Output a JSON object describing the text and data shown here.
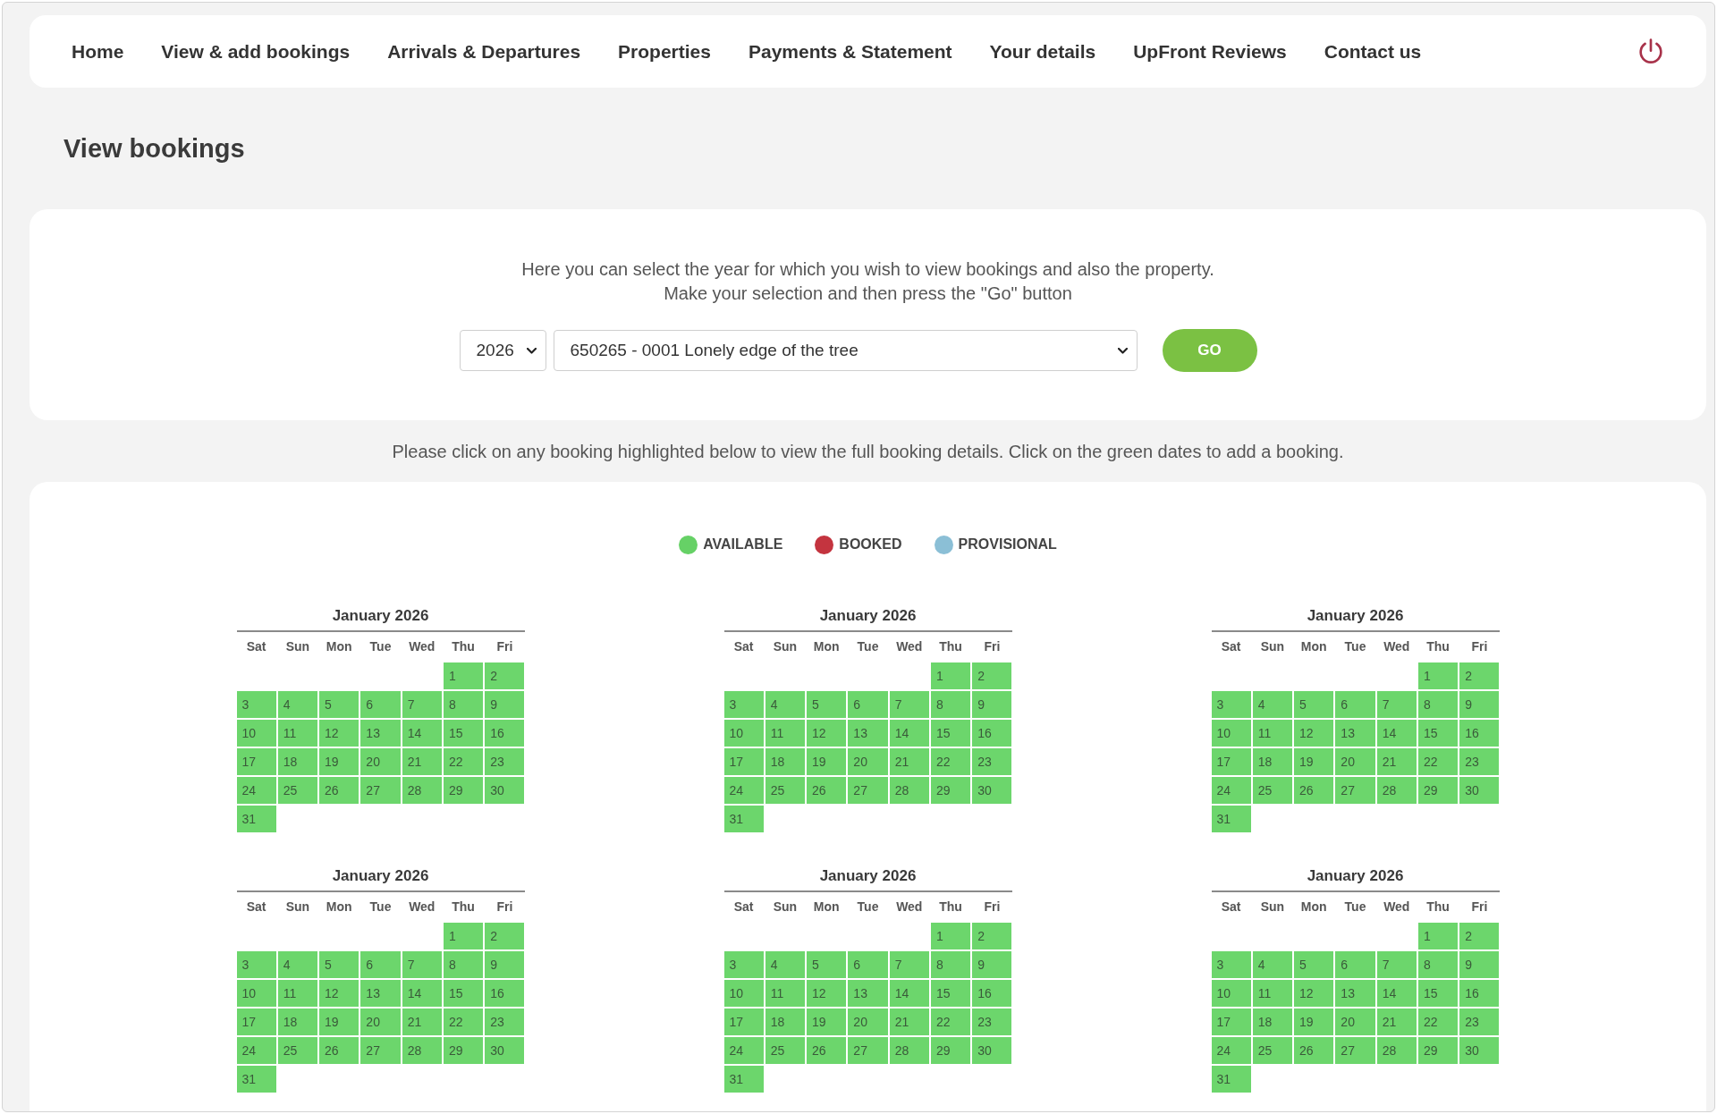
{
  "nav": {
    "links": [
      "Home",
      "View & add bookings",
      "Arrivals & Departures",
      "Properties",
      "Payments & Statement",
      "Your details",
      "UpFront Reviews",
      "Contact us"
    ]
  },
  "page_title": "View bookings",
  "selection_panel": {
    "intro": [
      "Here you can select the year for which you wish to view bookings and also the property.",
      "Make your selection and then press the \"Go\" button"
    ],
    "year_select": {
      "value": "2026"
    },
    "property_select": {
      "value": "650265 - 0001 Lonely edge of the tree"
    },
    "go_button": "GO"
  },
  "instruction": "Please click on any booking highlighted below to view the full booking details. Click on the green dates to add a booking.",
  "calendar_panel": {
    "legend": [
      {
        "label": "AVAILABLE",
        "color": "#66d166"
      },
      {
        "label": "BOOKED",
        "color": "#c4343f"
      },
      {
        "label": "PROVISIONAL",
        "color": "#8bbfd6"
      }
    ],
    "calendars": [
      {
        "title": "January 2026",
        "weekdays": [
          "Sat",
          "Sun",
          "Mon",
          "Tue",
          "Wed",
          "Thu",
          "Fri"
        ],
        "weeks": [
          [
            {
              "day": "1",
              "color": "#6cd66c"
            },
            {
              "day": "2",
              "color": "#6cd66c"
            }
          ],
          [
            {
              "day": "3",
              "color": "#6cd66c"
            },
            {
              "day": "4",
              "color": "#6cd66c"
            },
            {
              "day": "5",
              "color": "#6cd66c"
            },
            {
              "day": "6",
              "color": "#6cd66c"
            },
            {
              "day": "7",
              "color": "#6cd66c"
            },
            {
              "day": "8",
              "color": "#6cd66c"
            },
            {
              "day": "9",
              "color": "#6cd66c"
            }
          ],
          [
            {
              "day": "10",
              "color": "#6cd66c"
            },
            {
              "day": "11",
              "color": "#6cd66c"
            },
            {
              "day": "12",
              "color": "#6cd66c"
            },
            {
              "day": "13",
              "color": "#6cd66c"
            },
            {
              "day": "14",
              "color": "#6cd66c"
            },
            {
              "day": "15",
              "color": "#6cd66c"
            },
            {
              "day": "16",
              "color": "#6cd66c"
            }
          ],
          [
            {
              "day": "17",
              "color": "#6cd66c"
            },
            {
              "day": "18",
              "color": "#6cd66c"
            },
            {
              "day": "19",
              "color": "#6cd66c"
            },
            {
              "day": "20",
              "color": "#6cd66c"
            },
            {
              "day": "21",
              "color": "#6cd66c"
            },
            {
              "day": "22",
              "color": "#6cd66c"
            },
            {
              "day": "23",
              "color": "#6cd66c"
            }
          ],
          [
            {
              "day": "24",
              "color": "#6cd66c"
            },
            {
              "day": "25",
              "color": "#6cd66c"
            },
            {
              "day": "26",
              "color": "#6cd66c"
            },
            {
              "day": "27",
              "color": "#6cd66c"
            },
            {
              "day": "28",
              "color": "#6cd66c"
            },
            {
              "day": "29",
              "color": "#6cd66c"
            },
            {
              "day": "30",
              "color": "#6cd66c"
            }
          ],
          [
            {
              "day": "31",
              "color": "#6cd66c"
            }
          ]
        ]
      },
      {
        "title": "January 2026",
        "weekdays": [
          "Sat",
          "Sun",
          "Mon",
          "Tue",
          "Wed",
          "Thu",
          "Fri"
        ],
        "weeks": [
          [
            {
              "day": "1",
              "color": "#6cd66c"
            },
            {
              "day": "2",
              "color": "#6cd66c"
            }
          ],
          [
            {
              "day": "3",
              "color": "#6cd66c"
            },
            {
              "day": "4",
              "color": "#6cd66c"
            },
            {
              "day": "5",
              "color": "#6cd66c"
            },
            {
              "day": "6",
              "color": "#6cd66c"
            },
            {
              "day": "7",
              "color": "#6cd66c"
            },
            {
              "day": "8",
              "color": "#6cd66c"
            },
            {
              "day": "9",
              "color": "#6cd66c"
            }
          ],
          [
            {
              "day": "10",
              "color": "#6cd66c"
            },
            {
              "day": "11",
              "color": "#6cd66c"
            },
            {
              "day": "12",
              "color": "#6cd66c"
            },
            {
              "day": "13",
              "color": "#6cd66c"
            },
            {
              "day": "14",
              "color": "#6cd66c"
            },
            {
              "day": "15",
              "color": "#6cd66c"
            },
            {
              "day": "16",
              "color": "#6cd66c"
            }
          ],
          [
            {
              "day": "17",
              "color": "#6cd66c"
            },
            {
              "day": "18",
              "color": "#6cd66c"
            },
            {
              "day": "19",
              "color": "#6cd66c"
            },
            {
              "day": "20",
              "color": "#6cd66c"
            },
            {
              "day": "21",
              "color": "#6cd66c"
            },
            {
              "day": "22",
              "color": "#6cd66c"
            },
            {
              "day": "23",
              "color": "#6cd66c"
            }
          ],
          [
            {
              "day": "24",
              "color": "#6cd66c"
            },
            {
              "day": "25",
              "color": "#6cd66c"
            },
            {
              "day": "26",
              "color": "#6cd66c"
            },
            {
              "day": "27",
              "color": "#6cd66c"
            },
            {
              "day": "28",
              "color": "#6cd66c"
            },
            {
              "day": "29",
              "color": "#6cd66c"
            },
            {
              "day": "30",
              "color": "#6cd66c"
            }
          ],
          [
            {
              "day": "31",
              "color": "#6cd66c"
            }
          ]
        ]
      },
      {
        "title": "January 2026",
        "weekdays": [
          "Sat",
          "Sun",
          "Mon",
          "Tue",
          "Wed",
          "Thu",
          "Fri"
        ],
        "weeks": [
          [
            {
              "day": "1",
              "color": "#6cd66c"
            },
            {
              "day": "2",
              "color": "#6cd66c"
            }
          ],
          [
            {
              "day": "3",
              "color": "#6cd66c"
            },
            {
              "day": "4",
              "color": "#6cd66c"
            },
            {
              "day": "5",
              "color": "#6cd66c"
            },
            {
              "day": "6",
              "color": "#6cd66c"
            },
            {
              "day": "7",
              "color": "#6cd66c"
            },
            {
              "day": "8",
              "color": "#6cd66c"
            },
            {
              "day": "9",
              "color": "#6cd66c"
            }
          ],
          [
            {
              "day": "10",
              "color": "#6cd66c"
            },
            {
              "day": "11",
              "color": "#6cd66c"
            },
            {
              "day": "12",
              "color": "#6cd66c"
            },
            {
              "day": "13",
              "color": "#6cd66c"
            },
            {
              "day": "14",
              "color": "#6cd66c"
            },
            {
              "day": "15",
              "color": "#6cd66c"
            },
            {
              "day": "16",
              "color": "#6cd66c"
            }
          ],
          [
            {
              "day": "17",
              "color": "#6cd66c"
            },
            {
              "day": "18",
              "color": "#6cd66c"
            },
            {
              "day": "19",
              "color": "#6cd66c"
            },
            {
              "day": "20",
              "color": "#6cd66c"
            },
            {
              "day": "21",
              "color": "#6cd66c"
            },
            {
              "day": "22",
              "color": "#6cd66c"
            },
            {
              "day": "23",
              "color": "#6cd66c"
            }
          ],
          [
            {
              "day": "24",
              "color": "#6cd66c"
            },
            {
              "day": "25",
              "color": "#6cd66c"
            },
            {
              "day": "26",
              "color": "#6cd66c"
            },
            {
              "day": "27",
              "color": "#6cd66c"
            },
            {
              "day": "28",
              "color": "#6cd66c"
            },
            {
              "day": "29",
              "color": "#6cd66c"
            },
            {
              "day": "30",
              "color": "#6cd66c"
            }
          ],
          [
            {
              "day": "31",
              "color": "#6cd66c"
            }
          ]
        ]
      },
      {
        "title": "January 2026",
        "weekdays": [
          "Sat",
          "Sun",
          "Mon",
          "Tue",
          "Wed",
          "Thu",
          "Fri"
        ],
        "weeks": [
          [
            {
              "day": "1",
              "color": "#6cd66c"
            },
            {
              "day": "2",
              "color": "#6cd66c"
            }
          ],
          [
            {
              "day": "3",
              "color": "#6cd66c"
            },
            {
              "day": "4",
              "color": "#6cd66c"
            },
            {
              "day": "5",
              "color": "#6cd66c"
            },
            {
              "day": "6",
              "color": "#6cd66c"
            },
            {
              "day": "7",
              "color": "#6cd66c"
            },
            {
              "day": "8",
              "color": "#6cd66c"
            },
            {
              "day": "9",
              "color": "#6cd66c"
            }
          ],
          [
            {
              "day": "10",
              "color": "#6cd66c"
            },
            {
              "day": "11",
              "color": "#6cd66c"
            },
            {
              "day": "12",
              "color": "#6cd66c"
            },
            {
              "day": "13",
              "color": "#6cd66c"
            },
            {
              "day": "14",
              "color": "#6cd66c"
            },
            {
              "day": "15",
              "color": "#6cd66c"
            },
            {
              "day": "16",
              "color": "#6cd66c"
            }
          ],
          [
            {
              "day": "17",
              "color": "#6cd66c"
            },
            {
              "day": "18",
              "color": "#6cd66c"
            },
            {
              "day": "19",
              "color": "#6cd66c"
            },
            {
              "day": "20",
              "color": "#6cd66c"
            },
            {
              "day": "21",
              "color": "#6cd66c"
            },
            {
              "day": "22",
              "color": "#6cd66c"
            },
            {
              "day": "23",
              "color": "#6cd66c"
            }
          ],
          [
            {
              "day": "24",
              "color": "#6cd66c"
            },
            {
              "day": "25",
              "color": "#6cd66c"
            },
            {
              "day": "26",
              "color": "#6cd66c"
            },
            {
              "day": "27",
              "color": "#6cd66c"
            },
            {
              "day": "28",
              "color": "#6cd66c"
            },
            {
              "day": "29",
              "color": "#6cd66c"
            },
            {
              "day": "30",
              "color": "#6cd66c"
            }
          ],
          [
            {
              "day": "31",
              "color": "#6cd66c"
            }
          ]
        ]
      },
      {
        "title": "January 2026",
        "weekdays": [
          "Sat",
          "Sun",
          "Mon",
          "Tue",
          "Wed",
          "Thu",
          "Fri"
        ],
        "weeks": [
          [
            {
              "day": "1",
              "color": "#6cd66c"
            },
            {
              "day": "2",
              "color": "#6cd66c"
            }
          ],
          [
            {
              "day": "3",
              "color": "#6cd66c"
            },
            {
              "day": "4",
              "color": "#6cd66c"
            },
            {
              "day": "5",
              "color": "#6cd66c"
            },
            {
              "day": "6",
              "color": "#6cd66c"
            },
            {
              "day": "7",
              "color": "#6cd66c"
            },
            {
              "day": "8",
              "color": "#6cd66c"
            },
            {
              "day": "9",
              "color": "#6cd66c"
            }
          ],
          [
            {
              "day": "10",
              "color": "#6cd66c"
            },
            {
              "day": "11",
              "color": "#6cd66c"
            },
            {
              "day": "12",
              "color": "#6cd66c"
            },
            {
              "day": "13",
              "color": "#6cd66c"
            },
            {
              "day": "14",
              "color": "#6cd66c"
            },
            {
              "day": "15",
              "color": "#6cd66c"
            },
            {
              "day": "16",
              "color": "#6cd66c"
            }
          ],
          [
            {
              "day": "17",
              "color": "#6cd66c"
            },
            {
              "day": "18",
              "color": "#6cd66c"
            },
            {
              "day": "19",
              "color": "#6cd66c"
            },
            {
              "day": "20",
              "color": "#6cd66c"
            },
            {
              "day": "21",
              "color": "#6cd66c"
            },
            {
              "day": "22",
              "color": "#6cd66c"
            },
            {
              "day": "23",
              "color": "#6cd66c"
            }
          ],
          [
            {
              "day": "24",
              "color": "#6cd66c"
            },
            {
              "day": "25",
              "color": "#6cd66c"
            },
            {
              "day": "26",
              "color": "#6cd66c"
            },
            {
              "day": "27",
              "color": "#6cd66c"
            },
            {
              "day": "28",
              "color": "#6cd66c"
            },
            {
              "day": "29",
              "color": "#6cd66c"
            },
            {
              "day": "30",
              "color": "#6cd66c"
            }
          ],
          [
            {
              "day": "31",
              "color": "#6cd66c"
            }
          ]
        ]
      },
      {
        "title": "January 2026",
        "weekdays": [
          "Sat",
          "Sun",
          "Mon",
          "Tue",
          "Wed",
          "Thu",
          "Fri"
        ],
        "weeks": [
          [
            {
              "day": "1",
              "color": "#6cd66c"
            },
            {
              "day": "2",
              "color": "#6cd66c"
            }
          ],
          [
            {
              "day": "3",
              "color": "#6cd66c"
            },
            {
              "day": "4",
              "color": "#6cd66c"
            },
            {
              "day": "5",
              "color": "#6cd66c"
            },
            {
              "day": "6",
              "color": "#6cd66c"
            },
            {
              "day": "7",
              "color": "#6cd66c"
            },
            {
              "day": "8",
              "color": "#6cd66c"
            },
            {
              "day": "9",
              "color": "#6cd66c"
            }
          ],
          [
            {
              "day": "10",
              "color": "#6cd66c"
            },
            {
              "day": "11",
              "color": "#6cd66c"
            },
            {
              "day": "12",
              "color": "#6cd66c"
            },
            {
              "day": "13",
              "color": "#6cd66c"
            },
            {
              "day": "14",
              "color": "#6cd66c"
            },
            {
              "day": "15",
              "color": "#6cd66c"
            },
            {
              "day": "16",
              "color": "#6cd66c"
            }
          ],
          [
            {
              "day": "17",
              "color": "#6cd66c"
            },
            {
              "day": "18",
              "color": "#6cd66c"
            },
            {
              "day": "19",
              "color": "#6cd66c"
            },
            {
              "day": "20",
              "color": "#6cd66c"
            },
            {
              "day": "21",
              "color": "#6cd66c"
            },
            {
              "day": "22",
              "color": "#6cd66c"
            },
            {
              "day": "23",
              "color": "#6cd66c"
            }
          ],
          [
            {
              "day": "24",
              "color": "#6cd66c"
            },
            {
              "day": "25",
              "color": "#6cd66c"
            },
            {
              "day": "26",
              "color": "#6cd66c"
            },
            {
              "day": "27",
              "color": "#6cd66c"
            },
            {
              "day": "28",
              "color": "#6cd66c"
            },
            {
              "day": "29",
              "color": "#6cd66c"
            },
            {
              "day": "30",
              "color": "#6cd66c"
            }
          ],
          [
            {
              "day": "31",
              "color": "#6cd66c"
            }
          ]
        ]
      }
    ]
  }
}
